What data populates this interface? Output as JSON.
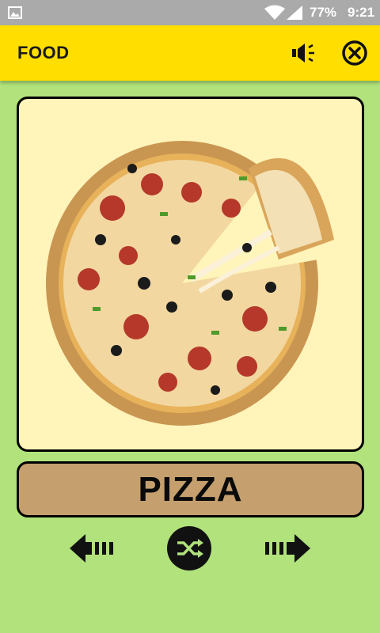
{
  "status_bar": {
    "battery": "77%",
    "time": "9:21",
    "icons": [
      "image-icon",
      "wifi-icon",
      "signal-icon"
    ]
  },
  "header": {
    "title": "FOOD",
    "icons": [
      "speaker-icon",
      "close-circle-icon"
    ]
  },
  "card": {
    "word": "PIZZA",
    "image_subject": "pizza-image"
  },
  "controls": {
    "icons": [
      "arrow-left-icon",
      "shuffle-icon",
      "arrow-right-icon"
    ]
  },
  "colors": {
    "background": "#b1e27c",
    "header": "#ffde00",
    "card": "#fff4b9",
    "word_box": "#c5a06e"
  }
}
